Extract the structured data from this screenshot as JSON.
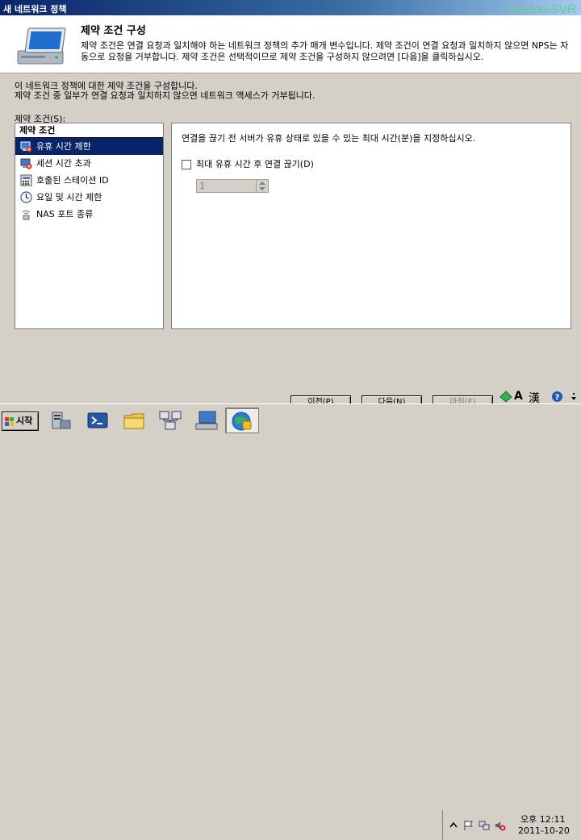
{
  "window": {
    "title": "새 네트워크 정책",
    "watermark": "London-SVR"
  },
  "header": {
    "title": "제약 조건 구성",
    "description": "제약 조건은 연결 요청과 일치해야 하는 네트워크 정책의 추가 매개 변수입니다. 제약 조건이 연결 요청과 일치하지 않으면 NPS는 자동으로 요청을 거부합니다. 제약 조건은 선택적이므로 제약 조건을 구성하지 않으려면 [다음]을 클릭하십시오."
  },
  "intro": {
    "line1": "이 네트워크 정책에 대한 제약 조건을 구성합니다.",
    "line2": "제약 조건 중 일부가 연결 요청과 일치하지 않으면 네트워크 액세스가 거부됩니다."
  },
  "constraints": {
    "label": "제약 조건(S):",
    "header": "제약 조건",
    "items": [
      {
        "label": "유휴 시간 제한",
        "icon": "idle-timeout-icon"
      },
      {
        "label": "세션 시간 초과",
        "icon": "session-timeout-icon"
      },
      {
        "label": "호출된 스테이션 ID",
        "icon": "station-id-icon"
      },
      {
        "label": "요일 및 시간 제한",
        "icon": "clock-icon"
      },
      {
        "label": "NAS 포트 종류",
        "icon": "nas-port-icon"
      }
    ],
    "selected_index": 0
  },
  "detail": {
    "description": "연결을 끊기 전 서버가 유휴 상태로 있을 수 있는 최대 시간(분)을 지정하십시오.",
    "checkbox_label": "최대 유휴 시간 후 연결 끊기(D)",
    "checkbox_checked": false,
    "spinner_value": "1"
  },
  "buttons": {
    "previous": "이전(P)",
    "next": "다음(N)",
    "finish": "마침(F)"
  },
  "taskbar": {
    "start_label": "시작",
    "apps": [
      "server-manager-icon",
      "powershell-icon",
      "explorer-icon",
      "network-icon",
      "computer-management-icon",
      "nps-icon"
    ],
    "language_bar": {
      "mode": "A",
      "hanja": "漢"
    },
    "clock": {
      "time": "오후 12:11",
      "date": "2011-10-20"
    }
  }
}
